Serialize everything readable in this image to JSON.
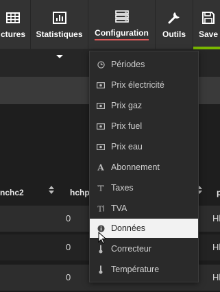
{
  "toolbar": {
    "tools": [
      {
        "label": "ctures",
        "icon": "table-icon"
      },
      {
        "label": "Statistiques",
        "icon": "bar-chart-icon"
      },
      {
        "label": "Configuration",
        "icon": "server-icon"
      },
      {
        "label": "Outils",
        "icon": "wrench-icon"
      },
      {
        "label": "Save",
        "icon": "floppy-icon"
      }
    ],
    "accent_color": "#7ab800",
    "active_underline_color": "#e05a5a"
  },
  "table": {
    "headers": [
      "nchc2",
      "hchp",
      "p"
    ],
    "rows": [
      {
        "hchp": "0",
        "p": "Hl"
      },
      {
        "hchp": "0",
        "p": "Hl"
      },
      {
        "hchp": "0",
        "p": "Hl"
      }
    ]
  },
  "menu": {
    "items": [
      {
        "label": "Périodes",
        "icon": "clock-icon"
      },
      {
        "label": "Prix électricité",
        "icon": "banknote-icon"
      },
      {
        "label": "Prix gaz",
        "icon": "banknote-icon"
      },
      {
        "label": "Prix fuel",
        "icon": "banknote-icon"
      },
      {
        "label": "Prix eau",
        "icon": "banknote-icon"
      },
      {
        "label": "Abonnement",
        "icon": "font-icon"
      },
      {
        "label": "Taxes",
        "icon": "text-height-icon"
      },
      {
        "label": "TVA",
        "icon": "text-width-icon"
      },
      {
        "label": "Données",
        "icon": "info-circle-icon"
      },
      {
        "label": "Correcteur",
        "icon": "thermometer-icon"
      },
      {
        "label": "Température",
        "icon": "thermometer-icon"
      }
    ],
    "hovered_index": 8
  }
}
